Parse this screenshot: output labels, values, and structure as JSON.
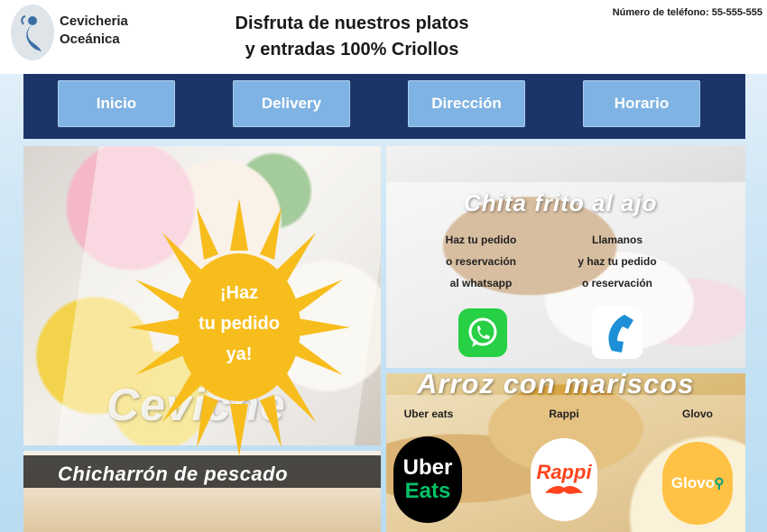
{
  "header": {
    "brand_line1": "Cevicheria",
    "brand_line2": "Oceánica",
    "tagline_line1": "Disfruta de nuestros platos",
    "tagline_line2": "y entradas 100% Criollos",
    "phone": "Número de teléfono: 55-555-555"
  },
  "nav": {
    "items": [
      {
        "label": "Inicio"
      },
      {
        "label": "Delivery"
      },
      {
        "label": "Dirección"
      },
      {
        "label": "Horario"
      }
    ]
  },
  "promo": {
    "line1": "¡Haz",
    "line2": "tu pedido",
    "line3": "ya!"
  },
  "dishes": {
    "ceviche": "Ceviche",
    "chicharron": "Chicharrón de pescado",
    "chita": "Chita frito al ajo",
    "arroz": "Arroz con mariscos"
  },
  "order": {
    "whatsapp_line1": "Haz tu pedido",
    "whatsapp_line2": "o reservación",
    "whatsapp_line3": "al whatsapp",
    "call_line1": "Llamanos",
    "call_line2": "y haz tu pedido",
    "call_line3": "o reservación"
  },
  "delivery_apps": [
    {
      "name": "Uber eats",
      "logo_line1": "Uber",
      "logo_line2": "Eats",
      "color": "#000000",
      "accent": "#06c167"
    },
    {
      "name": "Rappi",
      "logo": "Rappi",
      "color": "#ff441f"
    },
    {
      "name": "Glovo",
      "logo": "Glovo",
      "color": "#ffc244"
    }
  ],
  "colors": {
    "nav_bg": "#1c3569",
    "nav_button": "#7fb3e3",
    "sun": "#f7bd1d"
  },
  "icons": {
    "logo": "mermaid-logo-icon",
    "whatsapp": "whatsapp-icon",
    "phone": "phone-icon"
  }
}
